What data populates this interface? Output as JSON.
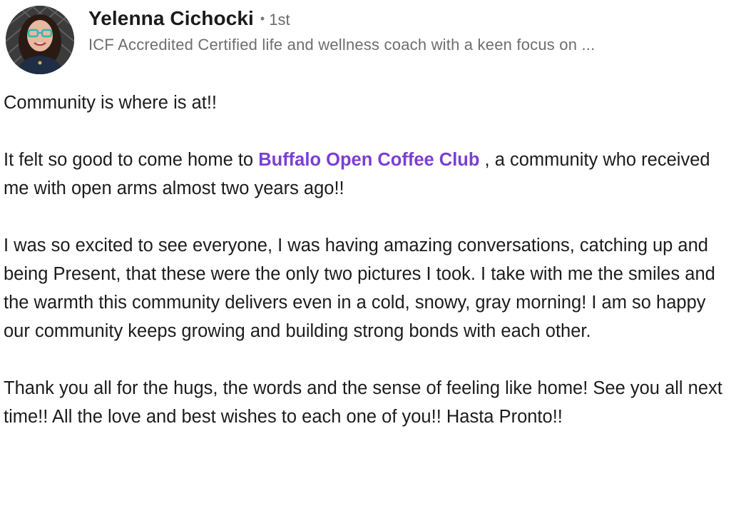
{
  "post": {
    "author": {
      "name": "Yelenna Cichocki",
      "separator": "•",
      "connection_degree": "1st",
      "headline": "ICF Accredited Certified life and wellness coach with a keen focus on ..."
    },
    "paragraphs": {
      "p1": "Community is where is at!!",
      "p2_before": "It felt so good to come home to ",
      "p2_mention": "Buffalo Open Coffee Club",
      "p2_after": " , a community who received me with open arms almost two years ago!!",
      "p3": "I was so excited to see everyone, I was having amazing conversations, catching up and being Present, that these were the only two pictures I took. I take with me the smiles and the warmth this community delivers even in a cold, snowy, gray morning! I am so happy our community keeps growing and building strong bonds with each other.",
      "p4": "Thank you all for the hugs, the words and the sense of feeling like home! See you all next time!! All the love and best wishes to each one of you!! Hasta Pronto!!"
    },
    "colors": {
      "mention": "#7b3fd3",
      "text": "#1c1c1c",
      "muted": "#6e6e6e"
    }
  }
}
